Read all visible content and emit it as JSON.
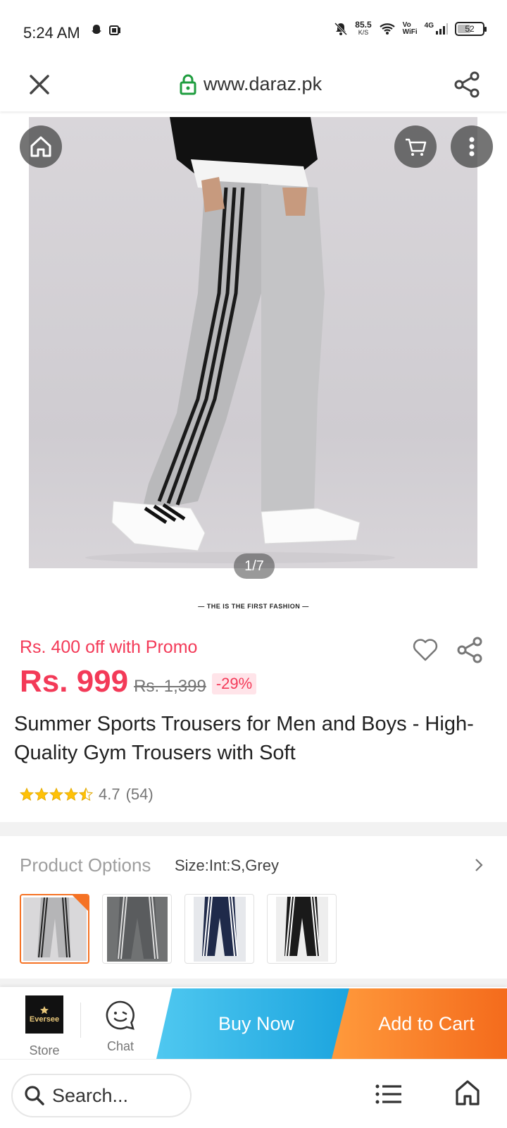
{
  "status_bar": {
    "time": "5:24 AM",
    "speed_value": "85.5",
    "speed_unit": "K/S",
    "vo": "Vo",
    "wifi": "WiFi",
    "network": "4G",
    "battery": "52"
  },
  "url_bar": {
    "url": "www.daraz.pk"
  },
  "gallery": {
    "counter": "1/7",
    "tagline": "— THE IS THE FIRST FASHION —"
  },
  "price": {
    "promo": "Rs. 400 off with Promo",
    "current": "Rs. 999",
    "original": "Rs. 1,399",
    "discount": "-29%"
  },
  "product": {
    "title": "Summer Sports Trousers for Men and Boys - High-Quality Gym Trousers with Soft",
    "rating_value": "4.7",
    "rating_count": "(54)",
    "stars": 4.5
  },
  "options": {
    "label": "Product Options",
    "value": "Size:Int:S,Grey"
  },
  "action_bar": {
    "store_name": "Eversee",
    "store_label": "Store",
    "chat_label": "Chat",
    "buy_now": "Buy Now",
    "add_to_cart": "Add to Cart"
  },
  "bottom_nav": {
    "search_placeholder": "Search..."
  },
  "colors": {
    "accent_red": "#f33a58",
    "buy_now": "#1aa3de",
    "add_to_cart": "#f46b1c",
    "star": "#ffc107"
  }
}
